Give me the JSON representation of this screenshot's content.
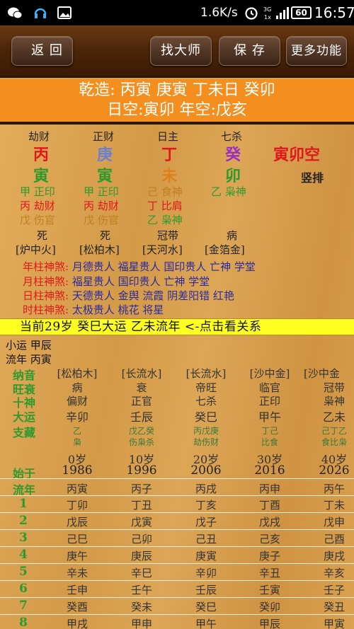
{
  "status": {
    "speed": "1.6K/s",
    "battery": "60",
    "time": "16:57"
  },
  "toolbar": {
    "back": "返 回",
    "find_master": "找大师",
    "save": "保 存",
    "more": "更多功能"
  },
  "header": {
    "line1": "乾造: 丙寅 庚寅 丁未日 癸卯",
    "line2": "日空:寅卯 年空:戊亥"
  },
  "pillars": {
    "top_labels": [
      "劫财",
      "正财",
      "日主",
      "七杀"
    ],
    "stems": [
      "丙",
      "庚",
      "丁",
      "癸"
    ],
    "stem_colors": [
      "#e0181c",
      "#6a7fd0",
      "#e0181c",
      "#9a2ec0"
    ],
    "branches": [
      "寅",
      "寅",
      "未",
      "卯"
    ],
    "branch_colors": [
      "#2e9a2e",
      "#2e9a2e",
      "#e0801c",
      "#2e9a2e"
    ],
    "empty_label": "寅卯空",
    "vertical_label": "竖排",
    "hidden": [
      [
        {
          "t": "甲 正印",
          "c": "#2e9a2e"
        },
        {
          "t": "丙 劫财",
          "c": "#e0181c"
        },
        {
          "t": "戊 伤官",
          "c": "#c08020"
        }
      ],
      [
        {
          "t": "甲 正印",
          "c": "#2e9a2e"
        },
        {
          "t": "丙 劫财",
          "c": "#e0181c"
        },
        {
          "t": "戊 伤官",
          "c": "#c08020"
        }
      ],
      [
        {
          "t": "己 食神",
          "c": "#c08020"
        },
        {
          "t": "丁 比肩",
          "c": "#e0181c"
        },
        {
          "t": "乙 枭神",
          "c": "#2e9a2e"
        }
      ],
      [
        {
          "t": "乙 枭神",
          "c": "#2e9a2e"
        }
      ]
    ],
    "stages": [
      "死",
      "死",
      "冠带",
      "病"
    ],
    "nayin": [
      "[炉中火]",
      "[松柏木]",
      "[天河水]",
      "[金箔金]"
    ]
  },
  "shensha": [
    {
      "k": "年柱神煞:",
      "v": "月德贵人 福星贵人 国印贵人 亡神 学堂"
    },
    {
      "k": "月柱神煞:",
      "v": "福星贵人 国印贵人 亡神 学堂"
    },
    {
      "k": "日柱神煞:",
      "v": "天德贵人 金舆 流霞 阴差阳错 红艳"
    },
    {
      "k": "时柱神煞:",
      "v": "太极贵人 桃花 将星"
    }
  ],
  "current": "当前29岁 癸巳大运 乙未流年  <-点击看关系",
  "minor_luck": "小运  甲辰",
  "flow_year": "流年  丙寅",
  "dayun": {
    "row_labels": {
      "nayin": "纳音",
      "wang": "旺衰",
      "shishen": "十神",
      "dayun": "大运",
      "zhicang": "支藏",
      "start": "始于",
      "liunian": "流年"
    },
    "nayin": [
      "[松柏木]",
      "[长流水]",
      "[长流水]",
      "[沙中金]",
      "[沙中金"
    ],
    "wang": [
      "病",
      "衰",
      "帝旺",
      "临官",
      "冠带"
    ],
    "shishen": [
      "偏财",
      "正官",
      "七杀",
      "正印",
      "枭神"
    ],
    "ganzhi": [
      "辛卯",
      "壬辰",
      "癸巳",
      "甲午",
      "乙未"
    ],
    "zhicang_top": [
      "乙",
      "戊乙癸",
      "丙戊庚",
      "丁己",
      "己丁乙"
    ],
    "zhicang_bottom": [
      "枭",
      "伤枭杀",
      "劫伤财",
      "比食",
      "食比枭"
    ],
    "ages": [
      "0岁",
      "10岁",
      "20岁",
      "30岁",
      "40岁"
    ],
    "start_years": [
      "1986",
      "1996",
      "2006",
      "2016",
      "2026"
    ],
    "liunian_header": [
      "丙寅",
      "丙子",
      "丙戌",
      "丙申",
      "丙午"
    ],
    "year_rows": [
      {
        "n": "1",
        "v": [
          "丁卯",
          "丁丑",
          "丁亥",
          "丁酉",
          "丁未"
        ]
      },
      {
        "n": "2",
        "v": [
          "戊辰",
          "戊寅",
          "戊子",
          "戊戌",
          "戊申"
        ]
      },
      {
        "n": "3",
        "v": [
          "己巳",
          "己卯",
          "己丑",
          "己亥",
          "己酉"
        ]
      },
      {
        "n": "4",
        "v": [
          "庚午",
          "庚辰",
          "庚寅",
          "庚子",
          "庚戌"
        ]
      },
      {
        "n": "5",
        "v": [
          "辛未",
          "辛巳",
          "辛卯",
          "辛丑",
          "辛亥"
        ]
      },
      {
        "n": "6",
        "v": [
          "壬申",
          "壬午",
          "壬辰",
          "壬寅",
          "壬子"
        ]
      },
      {
        "n": "7",
        "v": [
          "癸酉",
          "癸未",
          "癸巳",
          "癸卯",
          "癸丑"
        ]
      },
      {
        "n": "8",
        "v": [
          "甲戌",
          "甲申",
          "甲午",
          "甲辰",
          "甲寅"
        ]
      }
    ]
  },
  "colors": {
    "accent": "#f48e1f",
    "highlight": "#ffff22",
    "row_header": "#2e9a2e"
  }
}
